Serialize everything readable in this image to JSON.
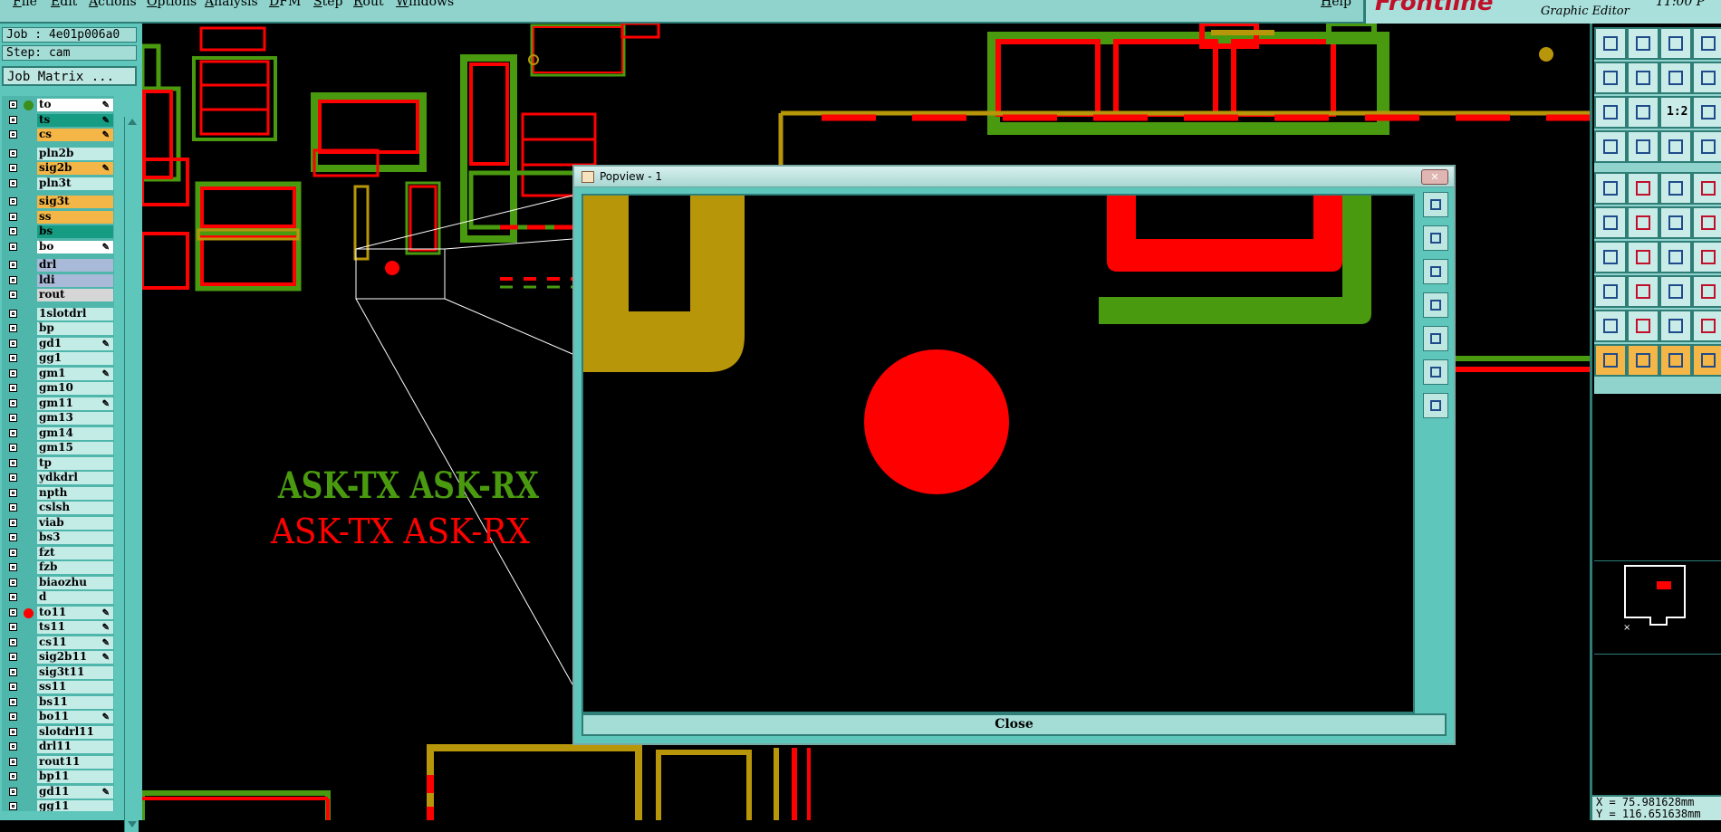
{
  "menubar": {
    "items": [
      "File",
      "Edit",
      "Actions",
      "Options",
      "Analysis",
      "DFM",
      "Step",
      "Rout",
      "Windows"
    ],
    "help": "Help"
  },
  "brand": {
    "logo": "Frontline",
    "subtitle": "Graphic Editor",
    "clock": "11:00 P"
  },
  "left": {
    "job": "Job : 4e01p006a0",
    "step": "Step: cam",
    "job_matrix": "Job Matrix ...",
    "layers": [
      {
        "name": "to",
        "color": "#ffffff",
        "dot": "#3b8f1a",
        "pen": true
      },
      {
        "name": "ts",
        "color": "#179c84",
        "dot": "",
        "pen": true
      },
      {
        "name": "cs",
        "color": "#f4b646",
        "dot": "",
        "pen": true
      },
      {
        "name": "pln2b",
        "color": "#c3ece7",
        "dot": "",
        "pen": false
      },
      {
        "name": "sig2b",
        "color": "#f4b646",
        "dot": "",
        "pen": true
      },
      {
        "name": "pln3t",
        "color": "#c3ece7",
        "dot": "",
        "pen": false
      },
      {
        "name": "sig3t",
        "color": "#f4b646",
        "dot": "",
        "pen": false
      },
      {
        "name": "ss",
        "color": "#f4b646",
        "dot": "",
        "pen": false
      },
      {
        "name": "bs",
        "color": "#179c84",
        "dot": "",
        "pen": false
      },
      {
        "name": "bo",
        "color": "#ffffff",
        "dot": "",
        "pen": true
      },
      {
        "name": "drl",
        "color": "#a9b9d8",
        "dot": "",
        "pen": false
      },
      {
        "name": "ldi",
        "color": "#a9b9d8",
        "dot": "",
        "pen": false
      },
      {
        "name": "rout",
        "color": "#d6d6d6",
        "dot": "",
        "pen": false
      },
      {
        "name": "1slotdrl",
        "color": "#c3ece7",
        "dot": "",
        "pen": false
      },
      {
        "name": "bp",
        "color": "#c3ece7",
        "dot": "",
        "pen": false
      },
      {
        "name": "gd1",
        "color": "#c3ece7",
        "dot": "",
        "pen": true
      },
      {
        "name": "gg1",
        "color": "#c3ece7",
        "dot": "",
        "pen": false
      },
      {
        "name": "gm1",
        "color": "#c3ece7",
        "dot": "",
        "pen": true
      },
      {
        "name": "gm10",
        "color": "#c3ece7",
        "dot": "",
        "pen": false
      },
      {
        "name": "gm11",
        "color": "#c3ece7",
        "dot": "",
        "pen": true
      },
      {
        "name": "gm13",
        "color": "#c3ece7",
        "dot": "",
        "pen": false
      },
      {
        "name": "gm14",
        "color": "#c3ece7",
        "dot": "",
        "pen": false
      },
      {
        "name": "gm15",
        "color": "#c3ece7",
        "dot": "",
        "pen": false
      },
      {
        "name": "tp",
        "color": "#c3ece7",
        "dot": "",
        "pen": false
      },
      {
        "name": "ydkdrl",
        "color": "#c3ece7",
        "dot": "",
        "pen": false
      },
      {
        "name": "npth",
        "color": "#c3ece7",
        "dot": "",
        "pen": false
      },
      {
        "name": "cslsh",
        "color": "#c3ece7",
        "dot": "",
        "pen": false
      },
      {
        "name": "viab",
        "color": "#c3ece7",
        "dot": "",
        "pen": false
      },
      {
        "name": "bs3",
        "color": "#c3ece7",
        "dot": "",
        "pen": false
      },
      {
        "name": "fzt",
        "color": "#c3ece7",
        "dot": "",
        "pen": false
      },
      {
        "name": "fzb",
        "color": "#c3ece7",
        "dot": "",
        "pen": false
      },
      {
        "name": "biaozhu",
        "color": "#c3ece7",
        "dot": "",
        "pen": false
      },
      {
        "name": "d",
        "color": "#c3ece7",
        "dot": "",
        "pen": false
      },
      {
        "name": "to11",
        "color": "#c3ece7",
        "dot": "#ff0000",
        "pen": true
      },
      {
        "name": "ts11",
        "color": "#c3ece7",
        "dot": "",
        "pen": true
      },
      {
        "name": "cs11",
        "color": "#c3ece7",
        "dot": "",
        "pen": true
      },
      {
        "name": "sig2b11",
        "color": "#c3ece7",
        "dot": "",
        "pen": true
      },
      {
        "name": "sig3t11",
        "color": "#c3ece7",
        "dot": "",
        "pen": false
      },
      {
        "name": "ss11",
        "color": "#c3ece7",
        "dot": "",
        "pen": false
      },
      {
        "name": "bs11",
        "color": "#c3ece7",
        "dot": "",
        "pen": false
      },
      {
        "name": "bo11",
        "color": "#c3ece7",
        "dot": "",
        "pen": true
      },
      {
        "name": "slotdrl11",
        "color": "#c3ece7",
        "dot": "",
        "pen": false
      },
      {
        "name": "drl11",
        "color": "#c3ece7",
        "dot": "",
        "pen": false
      },
      {
        "name": "rout11",
        "color": "#c3ece7",
        "dot": "",
        "pen": false
      },
      {
        "name": "bp11",
        "color": "#c3ece7",
        "dot": "",
        "pen": false
      },
      {
        "name": "gd11",
        "color": "#c3ece7",
        "dot": "",
        "pen": true
      },
      {
        "name": "gg11",
        "color": "#c3ece7",
        "dot": "",
        "pen": false
      }
    ]
  },
  "canvas": {
    "text_green": "ASK-TX ASK-RX",
    "text_red": "ASK-TX ASK-RX",
    "colors": {
      "red": "#ff0000",
      "green": "#4a9a10",
      "gold": "#b8960a"
    }
  },
  "popview": {
    "title": "Popview - 1",
    "close_x": "✕",
    "close_label": "Close",
    "tool_icons": [
      "zoom-home-icon",
      "zoom-in-icon",
      "zoom-out-icon",
      "pan-left-icon",
      "pan-right-icon",
      "zoom-fit-icon",
      "center-icon"
    ]
  },
  "right": {
    "coord_x": "X = 75.981628mm",
    "coord_y": "Y = 116.651638mm",
    "ratio_label": "1:2"
  }
}
